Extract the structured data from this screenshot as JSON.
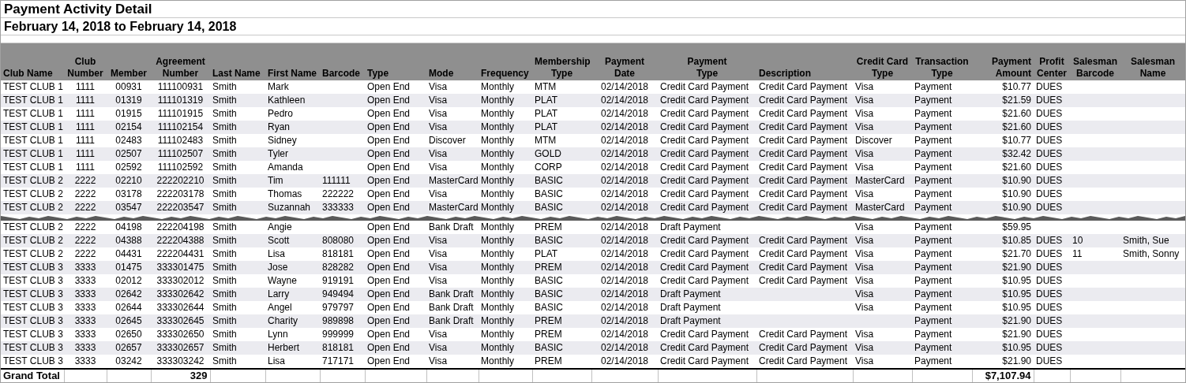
{
  "title": "Payment Activity Detail",
  "date_range": "February 14, 2018 to February 14, 2018",
  "columns": [
    "Club Name",
    "Club\nNumber",
    "Member",
    "Agreement\nNumber",
    "Last Name",
    "First Name",
    "Barcode",
    "Type",
    "Mode",
    "Frequency",
    "Membership\nType",
    "Payment\nDate",
    "Payment\nType",
    "Description",
    "Credit Card\nType",
    "Transaction\nType",
    "Payment\nAmount",
    "Profit\nCenter",
    "Salesman\nBarcode",
    "Salesman\nName"
  ],
  "rows": [
    {
      "kind": "record",
      "cells": [
        "TEST CLUB 1",
        "1111",
        "00931",
        "111100931",
        "Smith",
        "Mark",
        null,
        "Open End",
        "Visa",
        "Monthly",
        "MTM",
        "02/14/2018",
        "Credit Card Payment",
        "Credit Card Payment",
        "Visa",
        "Payment",
        "$10.77",
        "DUES",
        null,
        null
      ]
    },
    {
      "kind": "record",
      "cells": [
        "TEST CLUB 1",
        "1111",
        "01319",
        "111101319",
        "Smith",
        "Kathleen",
        null,
        "Open End",
        "Visa",
        "Monthly",
        "PLAT",
        "02/14/2018",
        "Credit Card Payment",
        "Credit Card Payment",
        "Visa",
        "Payment",
        "$21.59",
        "DUES",
        null,
        null
      ]
    },
    {
      "kind": "record",
      "cells": [
        "TEST CLUB 1",
        "1111",
        "01915",
        "111101915",
        "Smith",
        "Pedro",
        null,
        "Open End",
        "Visa",
        "Monthly",
        "PLAT",
        "02/14/2018",
        "Credit Card Payment",
        "Credit Card Payment",
        "Visa",
        "Payment",
        "$21.60",
        "DUES",
        null,
        null
      ]
    },
    {
      "kind": "record",
      "cells": [
        "TEST CLUB 1",
        "1111",
        "02154",
        "111102154",
        "Smith",
        "Ryan",
        null,
        "Open End",
        "Visa",
        "Monthly",
        "PLAT",
        "02/14/2018",
        "Credit Card Payment",
        "Credit Card Payment",
        "Visa",
        "Payment",
        "$21.60",
        "DUES",
        null,
        null
      ]
    },
    {
      "kind": "record",
      "cells": [
        "TEST CLUB 1",
        "1111",
        "02483",
        "111102483",
        "Smith",
        "Sidney",
        null,
        "Open End",
        "Discover",
        "Monthly",
        "MTM",
        "02/14/2018",
        "Credit Card Payment",
        "Credit Card Payment",
        "Discover",
        "Payment",
        "$10.77",
        "DUES",
        null,
        null
      ]
    },
    {
      "kind": "record",
      "cells": [
        "TEST CLUB 1",
        "1111",
        "02507",
        "111102507",
        "Smith",
        "Tyler",
        null,
        "Open End",
        "Visa",
        "Monthly",
        "GOLD",
        "02/14/2018",
        "Credit Card Payment",
        "Credit Card Payment",
        "Visa",
        "Payment",
        "$32.42",
        "DUES",
        null,
        null
      ]
    },
    {
      "kind": "record",
      "cells": [
        "TEST CLUB 1",
        "1111",
        "02592",
        "111102592",
        "Smith",
        "Amanda",
        null,
        "Open End",
        "Visa",
        "Monthly",
        "CORP",
        "02/14/2018",
        "Credit Card Payment",
        "Credit Card Payment",
        "Visa",
        "Payment",
        "$21.60",
        "DUES",
        null,
        null
      ]
    },
    {
      "kind": "record",
      "cells": [
        "TEST CLUB 2",
        "2222",
        "02210",
        "222202210",
        "Smith",
        "Tim",
        "111111",
        "Open End",
        "MasterCard",
        "Monthly",
        "BASIC",
        "02/14/2018",
        "Credit Card Payment",
        "Credit Card Payment",
        "MasterCard",
        "Payment",
        "$10.90",
        "DUES",
        null,
        null
      ]
    },
    {
      "kind": "record",
      "cells": [
        "TEST CLUB 2",
        "2222",
        "03178",
        "222203178",
        "Smith",
        "Thomas",
        "222222",
        "Open End",
        "Visa",
        "Monthly",
        "BASIC",
        "02/14/2018",
        "Credit Card Payment",
        "Credit Card Payment",
        "Visa",
        "Payment",
        "$10.90",
        "DUES",
        null,
        null
      ]
    },
    {
      "kind": "record",
      "cells": [
        "TEST CLUB 2",
        "2222",
        "03547",
        "222203547",
        "Smith",
        "Suzannah",
        "333333",
        "Open End",
        "MasterCard",
        "Monthly",
        "BASIC",
        "02/14/2018",
        "Credit Card Payment",
        "Credit Card Payment",
        "MasterCard",
        "Payment",
        "$10.90",
        "DUES",
        null,
        null
      ]
    },
    {
      "kind": "tear"
    },
    {
      "kind": "record",
      "cells": [
        "TEST CLUB 2",
        "2222",
        "04198",
        "222204198",
        "Smith",
        "Angie",
        null,
        "Open End",
        "Bank Draft",
        "Monthly",
        "PREM",
        "02/14/2018",
        "Draft Payment",
        null,
        "Visa",
        "Payment",
        "$59.95",
        null,
        null,
        null
      ]
    },
    {
      "kind": "record",
      "cells": [
        "TEST CLUB 2",
        "2222",
        "04388",
        "222204388",
        "Smith",
        "Scott",
        "808080",
        "Open End",
        "Visa",
        "Monthly",
        "BASIC",
        "02/14/2018",
        "Credit Card Payment",
        "Credit Card Payment",
        "Visa",
        "Payment",
        "$10.85",
        "DUES",
        "10",
        "Smith, Sue"
      ]
    },
    {
      "kind": "record",
      "cells": [
        "TEST CLUB 2",
        "2222",
        "04431",
        "222204431",
        "Smith",
        "Lisa",
        "818181",
        "Open End",
        "Visa",
        "Monthly",
        "PLAT",
        "02/14/2018",
        "Credit Card Payment",
        "Credit Card Payment",
        "Visa",
        "Payment",
        "$21.70",
        "DUES",
        "11",
        "Smith, Sonny"
      ]
    },
    {
      "kind": "record",
      "cells": [
        "TEST CLUB 3",
        "3333",
        "01475",
        "333301475",
        "Smith",
        "Jose",
        "828282",
        "Open End",
        "Visa",
        "Monthly",
        "PREM",
        "02/14/2018",
        "Credit Card Payment",
        "Credit Card Payment",
        "Visa",
        "Payment",
        "$21.90",
        "DUES",
        null,
        null
      ]
    },
    {
      "kind": "record",
      "cells": [
        "TEST CLUB 3",
        "3333",
        "02012",
        "333302012",
        "Smith",
        "Wayne",
        "919191",
        "Open End",
        "Visa",
        "Monthly",
        "BASIC",
        "02/14/2018",
        "Credit Card Payment",
        "Credit Card Payment",
        "Visa",
        "Payment",
        "$10.95",
        "DUES",
        null,
        null
      ]
    },
    {
      "kind": "record",
      "cells": [
        "TEST CLUB 3",
        "3333",
        "02642",
        "333302642",
        "Smith",
        "Larry",
        "949494",
        "Open End",
        "Bank Draft",
        "Monthly",
        "BASIC",
        "02/14/2018",
        "Draft Payment",
        null,
        "Visa",
        "Payment",
        "$10.95",
        "DUES",
        null,
        null
      ]
    },
    {
      "kind": "record",
      "cells": [
        "TEST CLUB 3",
        "3333",
        "02644",
        "333302644",
        "Smith",
        "Angel",
        "979797",
        "Open End",
        "Bank Draft",
        "Monthly",
        "BASIC",
        "02/14/2018",
        "Draft Payment",
        null,
        "Visa",
        "Payment",
        "$10.95",
        "DUES",
        null,
        null
      ]
    },
    {
      "kind": "record",
      "cells": [
        "TEST CLUB 3",
        "3333",
        "02645",
        "333302645",
        "Smith",
        "Charity",
        "989898",
        "Open End",
        "Bank Draft",
        "Monthly",
        "PREM",
        "02/14/2018",
        "Draft Payment",
        null,
        null,
        "Payment",
        "$21.90",
        "DUES",
        null,
        null
      ]
    },
    {
      "kind": "record",
      "cells": [
        "TEST CLUB 3",
        "3333",
        "02650",
        "333302650",
        "Smith",
        "Lynn",
        "999999",
        "Open End",
        "Visa",
        "Monthly",
        "PREM",
        "02/14/2018",
        "Credit Card Payment",
        "Credit Card Payment",
        "Visa",
        "Payment",
        "$21.90",
        "DUES",
        null,
        null
      ]
    },
    {
      "kind": "record",
      "cells": [
        "TEST CLUB 3",
        "3333",
        "02657",
        "333302657",
        "Smith",
        "Herbert",
        "818181",
        "Open End",
        "Visa",
        "Monthly",
        "BASIC",
        "02/14/2018",
        "Credit Card Payment",
        "Credit Card Payment",
        "Visa",
        "Payment",
        "$10.95",
        "DUES",
        null,
        null
      ]
    },
    {
      "kind": "record",
      "cells": [
        "TEST CLUB 3",
        "3333",
        "03242",
        "333303242",
        "Smith",
        "Lisa",
        "717171",
        "Open End",
        "Visa",
        "Monthly",
        "PREM",
        "02/14/2018",
        "Credit Card Payment",
        "Credit Card Payment",
        "Visa",
        "Payment",
        "$21.90",
        "DUES",
        null,
        null
      ]
    }
  ],
  "grand_total": {
    "label": "Grand Total",
    "agreement_number_total": "329",
    "payment_amount_total": "$7,107.94"
  }
}
